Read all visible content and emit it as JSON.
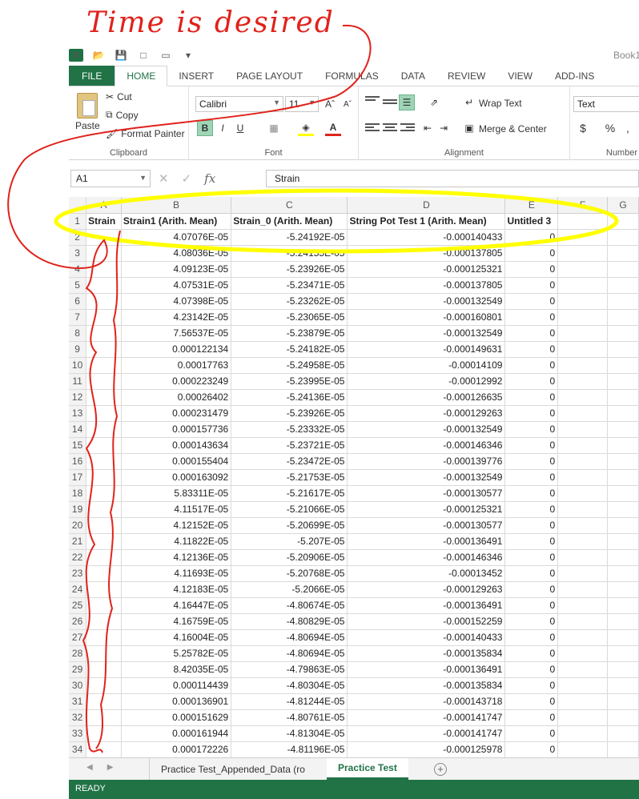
{
  "annotation": {
    "text": "Time is desired"
  },
  "window": {
    "book_title": "Book1"
  },
  "ribbon_tabs": [
    "FILE",
    "HOME",
    "INSERT",
    "PAGE LAYOUT",
    "FORMULAS",
    "DATA",
    "REVIEW",
    "VIEW",
    "ADD-INS"
  ],
  "clipboard": {
    "paste": "Paste",
    "cut": "Cut",
    "copy": "Copy",
    "format_painter": "Format Painter",
    "label": "Clipboard"
  },
  "font": {
    "name": "Calibri",
    "size": "11",
    "bold": "B",
    "italic": "I",
    "underline": "U",
    "label": "Font"
  },
  "alignment": {
    "wrap_text": "Wrap Text",
    "merge_center": "Merge & Center",
    "label": "Alignment"
  },
  "number": {
    "format": "Text",
    "currency": "$",
    "percent": "%",
    "comma": ",",
    "label": "Number"
  },
  "formula_bar": {
    "name_box": "A1",
    "formula": "Strain",
    "fx": "fx"
  },
  "grid": {
    "columns": [
      "A",
      "B",
      "C",
      "D",
      "E",
      "F",
      "G"
    ],
    "header_row": [
      "Strain",
      "Strain1 (Arith. Mean)",
      "Strain_0 (Arith. Mean)",
      "String Pot Test 1 (Arith. Mean)",
      "Untitled 3"
    ],
    "rows": [
      [
        "4.07076E-05",
        "-5.24192E-05",
        "-0.000140433",
        "0"
      ],
      [
        "4.08036E-05",
        "-5.24155E-05",
        "-0.000137805",
        "0"
      ],
      [
        "4.09123E-05",
        "-5.23926E-05",
        "-0.000125321",
        "0"
      ],
      [
        "4.07531E-05",
        "-5.23471E-05",
        "-0.000137805",
        "0"
      ],
      [
        "4.07398E-05",
        "-5.23262E-05",
        "-0.000132549",
        "0"
      ],
      [
        "4.23142E-05",
        "-5.23065E-05",
        "-0.000160801",
        "0"
      ],
      [
        "7.56537E-05",
        "-5.23879E-05",
        "-0.000132549",
        "0"
      ],
      [
        "0.000122134",
        "-5.24182E-05",
        "-0.000149631",
        "0"
      ],
      [
        "0.00017763",
        "-5.24958E-05",
        "-0.00014109",
        "0"
      ],
      [
        "0.000223249",
        "-5.23995E-05",
        "-0.00012992",
        "0"
      ],
      [
        "0.00026402",
        "-5.24136E-05",
        "-0.000126635",
        "0"
      ],
      [
        "0.000231479",
        "-5.23926E-05",
        "-0.000129263",
        "0"
      ],
      [
        "0.000157736",
        "-5.23332E-05",
        "-0.000132549",
        "0"
      ],
      [
        "0.000143634",
        "-5.23721E-05",
        "-0.000146346",
        "0"
      ],
      [
        "0.000155404",
        "-5.23472E-05",
        "-0.000139776",
        "0"
      ],
      [
        "0.000163092",
        "-5.21753E-05",
        "-0.000132549",
        "0"
      ],
      [
        "5.83311E-05",
        "-5.21617E-05",
        "-0.000130577",
        "0"
      ],
      [
        "4.11517E-05",
        "-5.21066E-05",
        "-0.000125321",
        "0"
      ],
      [
        "4.12152E-05",
        "-5.20699E-05",
        "-0.000130577",
        "0"
      ],
      [
        "4.11822E-05",
        "-5.207E-05",
        "-0.000136491",
        "0"
      ],
      [
        "4.12136E-05",
        "-5.20906E-05",
        "-0.000146346",
        "0"
      ],
      [
        "4.11693E-05",
        "-5.20768E-05",
        "-0.00013452",
        "0"
      ],
      [
        "4.12183E-05",
        "-5.2066E-05",
        "-0.000129263",
        "0"
      ],
      [
        "4.16447E-05",
        "-4.80674E-05",
        "-0.000136491",
        "0"
      ],
      [
        "4.16759E-05",
        "-4.80829E-05",
        "-0.000152259",
        "0"
      ],
      [
        "4.16004E-05",
        "-4.80694E-05",
        "-0.000140433",
        "0"
      ],
      [
        "5.25782E-05",
        "-4.80694E-05",
        "-0.000135834",
        "0"
      ],
      [
        "8.42035E-05",
        "-4.79863E-05",
        "-0.000136491",
        "0"
      ],
      [
        "0.000114439",
        "-4.80304E-05",
        "-0.000135834",
        "0"
      ],
      [
        "0.000136901",
        "-4.81244E-05",
        "-0.000143718",
        "0"
      ],
      [
        "0.000151629",
        "-4.80761E-05",
        "-0.000141747",
        "0"
      ],
      [
        "0.000161944",
        "-4.81304E-05",
        "-0.000141747",
        "0"
      ],
      [
        "0.000172226",
        "-4.81196E-05",
        "-0.000125978",
        "0"
      ]
    ]
  },
  "sheets": {
    "tab1": "Practice Test_Appended_Data (ro",
    "tab2": "Practice Test"
  },
  "status": {
    "text": "READY"
  },
  "colors": {
    "excel_green": "#217346",
    "annotation_red": "#e0221b",
    "highlight_yellow": "#ffff00"
  }
}
